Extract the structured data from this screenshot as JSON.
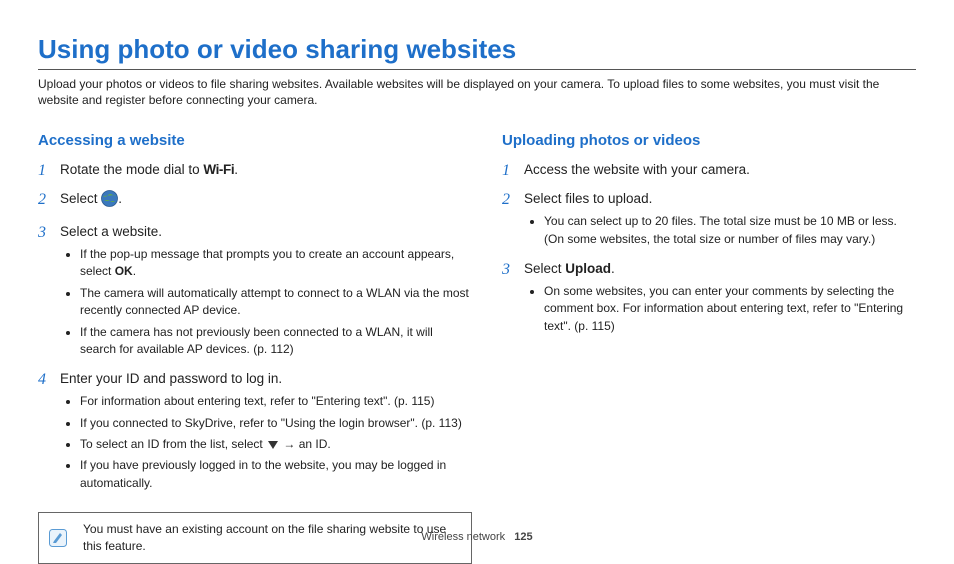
{
  "title": "Using photo or video sharing websites",
  "intro": "Upload your photos or videos to file sharing websites. Available websites will be displayed on your camera. To upload files to some websites, you must visit the website and register before connecting your camera.",
  "left": {
    "heading": "Accessing a website",
    "step1_num": "1",
    "step1_pre": "Rotate the mode dial to ",
    "step1_wifi": "Wi-Fi",
    "step1_post": ".",
    "step2_num": "2",
    "step2_pre": "Select ",
    "step2_post": ".",
    "step3_num": "3",
    "step3_text": "Select a website.",
    "step3_b1_pre": "If the pop-up message that prompts you to create an account appears, select ",
    "step3_b1_bold": "OK",
    "step3_b1_post": ".",
    "step3_b2": "The camera will automatically attempt to connect to a WLAN via the most recently connected AP device.",
    "step3_b3": "If the camera has not previously been connected to a WLAN, it will search for available AP devices. (p. 112)",
    "step4_num": "4",
    "step4_text": "Enter your ID and password to log in.",
    "step4_b1": "For information about entering text, refer to \"Entering text\". (p. 115)",
    "step4_b2": "If you connected to SkyDrive, refer to \"Using the login browser\". (p. 113)",
    "step4_b3_pre": "To select an ID from the list, select ",
    "step4_b3_post": " → an ID.",
    "step4_b4": "If you have previously logged in to the website, you may be logged in automatically.",
    "note": "You must have an existing account on the file sharing website to use this feature."
  },
  "right": {
    "heading": "Uploading photos or videos",
    "step1_num": "1",
    "step1_text": "Access the website with your camera.",
    "step2_num": "2",
    "step2_text": "Select files to upload.",
    "step2_b1": "You can select up to 20 files. The total size must be 10 MB or less. (On some websites, the total size or number of files may vary.)",
    "step3_num": "3",
    "step3_pre": "Select ",
    "step3_bold": "Upload",
    "step3_post": ".",
    "step3_b1": "On some websites, you can enter your comments by selecting the comment box. For information about entering text, refer to \"Entering text\". (p. 115)"
  },
  "footer_section": "Wireless network",
  "footer_page": "125"
}
